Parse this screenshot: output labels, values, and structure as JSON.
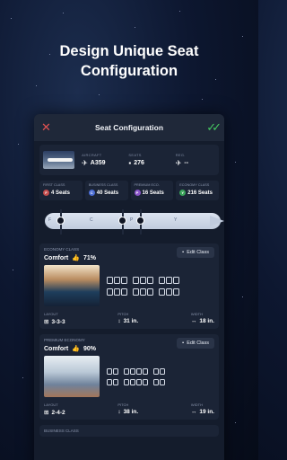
{
  "headline": {
    "line1": "Design Unique Seat",
    "line2": "Configuration"
  },
  "topbar": {
    "title": "Seat Configuration"
  },
  "aircraft": {
    "aircraft_label": "AIRCRAFT",
    "aircraft_value": "A359",
    "seats_label": "SEATS",
    "seats_value": "276",
    "reg_label": "REG.",
    "reg_value": "--"
  },
  "classes": [
    {
      "label": "FIRST CLASS",
      "value": "4 Seats",
      "badge": "F",
      "color": "#c44d4d"
    },
    {
      "label": "BUSINESS CLASS",
      "value": "40 Seats",
      "badge": "C",
      "color": "#4c6ed6"
    },
    {
      "label": "PREMIUM ECO.",
      "value": "16 Seats",
      "badge": "P",
      "color": "#8a55c9"
    },
    {
      "label": "ECONOMY CLASS",
      "value": "216 Seats",
      "badge": "Y",
      "color": "#3aa35a"
    }
  ],
  "fuselage": {
    "letters": [
      "F",
      "C",
      "P",
      "Y"
    ]
  },
  "economy": {
    "label": "ECONOMY CLASS",
    "rating": "Comfort",
    "score": "71%",
    "edit": "Edit Class",
    "layout_label": "LAYOUT",
    "layout": "3-3-3",
    "pitch_label": "PITCH",
    "pitch": "31 in.",
    "width_label": "WIDTH",
    "width": "18 in."
  },
  "premium": {
    "label": "PREMIUM ECONOMY",
    "rating": "Comfort",
    "score": "90%",
    "edit": "Edit Class",
    "layout_label": "LAYOUT",
    "layout": "2-4-2",
    "pitch_label": "PITCH",
    "pitch": "38 in.",
    "width_label": "WIDTH",
    "width": "19 in."
  },
  "business": {
    "label": "BUSINESS CLASS"
  }
}
